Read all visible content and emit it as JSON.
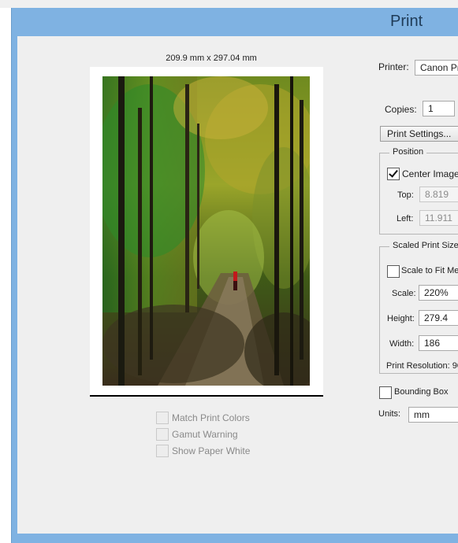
{
  "window": {
    "title": "Print"
  },
  "preview": {
    "dimensions": "209.9 mm x 297.04 mm",
    "options": [
      {
        "label": "Match Print Colors",
        "checked": false
      },
      {
        "label": "Gamut Warning",
        "checked": false
      },
      {
        "label": "Show Paper White",
        "checked": false
      }
    ]
  },
  "printer": {
    "label": "Printer:",
    "value": "Canon Pr"
  },
  "copies": {
    "label": "Copies:",
    "value": "1"
  },
  "print_settings_button": "Print Settings...",
  "position": {
    "title": "Position",
    "center_image": {
      "label": "Center Image",
      "checked": true
    },
    "top": {
      "label": "Top:",
      "value": "8.819"
    },
    "left": {
      "label": "Left:",
      "value": "11.911"
    }
  },
  "scaled_print_size": {
    "title": "Scaled Print Size",
    "scale_to_fit": {
      "label": "Scale to Fit Med",
      "checked": false
    },
    "scale": {
      "label": "Scale:",
      "value": "220%"
    },
    "height": {
      "label": "Height:",
      "value": "279.4"
    },
    "width": {
      "label": "Width:",
      "value": "186"
    },
    "print_resolution": {
      "label": "Print Resolution: 90"
    }
  },
  "bounding_box": {
    "label": "Bounding Box",
    "checked": false
  },
  "units": {
    "label": "Units:",
    "value": "mm"
  }
}
